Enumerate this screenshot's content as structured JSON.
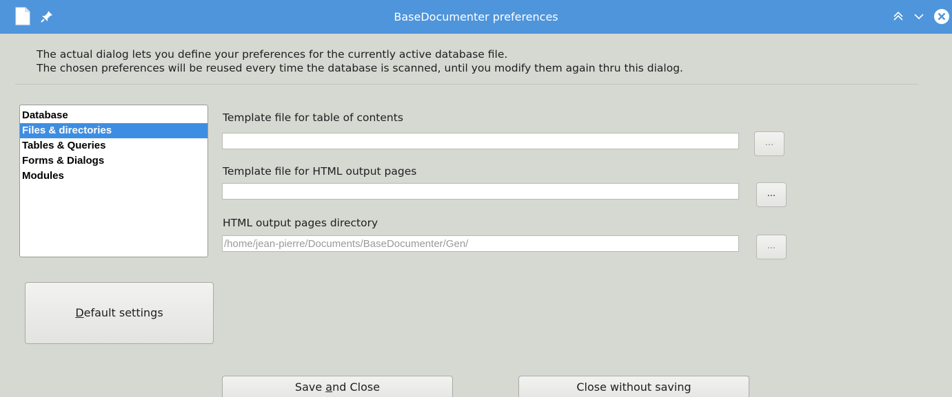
{
  "window": {
    "title": "BaseDocumenter preferences"
  },
  "intro": {
    "line1": "The actual dialog lets you define your preferences for the currently active database file.",
    "line2": "The chosen preferences will be reused every time the database is scanned, until you modify them again thru this dialog."
  },
  "categories": {
    "items": [
      {
        "label": "Database"
      },
      {
        "label": "Files & directories"
      },
      {
        "label": "Tables & Queries"
      },
      {
        "label": "Forms & Dialogs"
      },
      {
        "label": "Modules"
      }
    ],
    "selected": "Files & directories"
  },
  "fields": {
    "toc_template": {
      "label": "Template file for table of contents",
      "value": "",
      "browse_label": "..."
    },
    "html_template": {
      "label": "Template file for HTML output pages",
      "value": "",
      "browse_label": "..."
    },
    "output_dir": {
      "label": "HTML output pages directory",
      "value": "/home/jean-pierre/Documents/BaseDocumenter/Gen/",
      "browse_label": "..."
    }
  },
  "buttons": {
    "default_settings": {
      "mnemonic": "D",
      "rest": "efault settings"
    },
    "save_close": {
      "before": "Save ",
      "mnemonic": "a",
      "after": "nd Close"
    },
    "close_nosave": {
      "label": "Close without saving"
    }
  },
  "colors": {
    "titlebar": "#4f95db",
    "dialog_bg": "#d6d8d2",
    "selection": "#3d8ee2"
  }
}
